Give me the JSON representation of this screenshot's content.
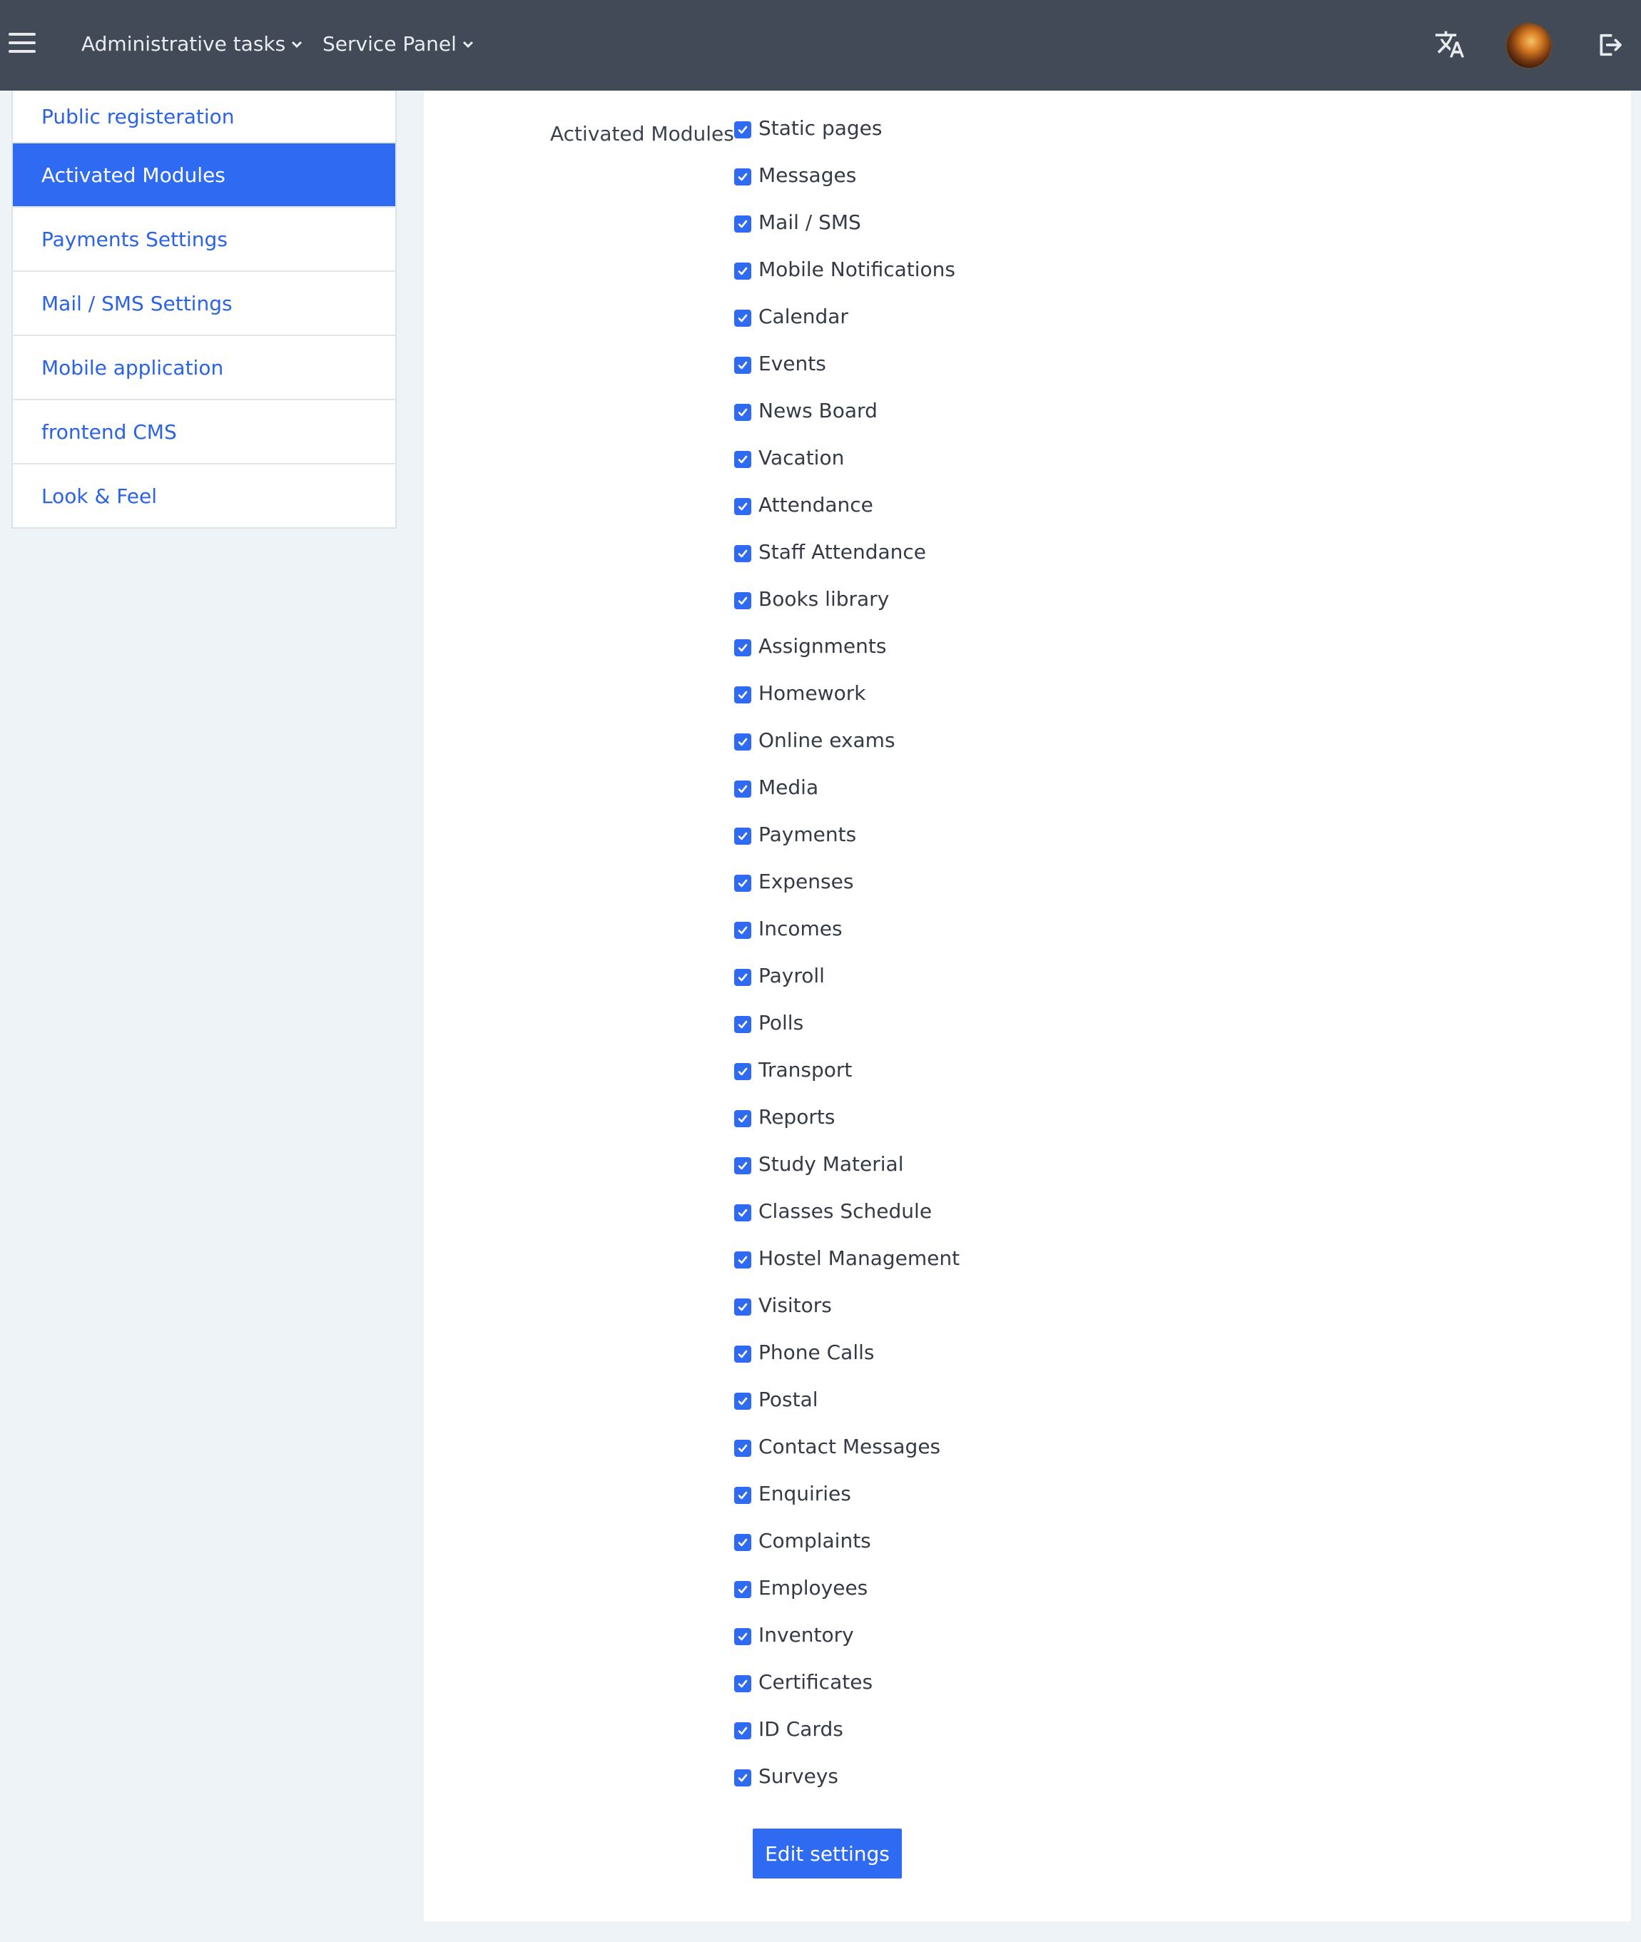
{
  "header": {
    "menu_icon": "hamburger-icon",
    "nav": [
      {
        "label": "Administrative tasks",
        "icon": "chevron-down-icon"
      },
      {
        "label": "Service Panel",
        "icon": "chevron-down-icon"
      }
    ],
    "right_icons": [
      "translate-icon",
      "avatar",
      "logout-icon"
    ]
  },
  "sidebar": {
    "items": [
      {
        "label": "Public registeration",
        "active": false
      },
      {
        "label": "Activated Modules",
        "active": true
      },
      {
        "label": "Payments Settings",
        "active": false
      },
      {
        "label": "Mail / SMS Settings",
        "active": false
      },
      {
        "label": "Mobile application",
        "active": false
      },
      {
        "label": "frontend CMS",
        "active": false
      },
      {
        "label": "Look & Feel",
        "active": false
      }
    ]
  },
  "form": {
    "label": "Activated Modules",
    "modules": [
      {
        "label": "Static pages",
        "checked": true
      },
      {
        "label": "Messages",
        "checked": true
      },
      {
        "label": "Mail / SMS",
        "checked": true
      },
      {
        "label": "Mobile Notifications",
        "checked": true
      },
      {
        "label": "Calendar",
        "checked": true
      },
      {
        "label": "Events",
        "checked": true
      },
      {
        "label": "News Board",
        "checked": true
      },
      {
        "label": "Vacation",
        "checked": true
      },
      {
        "label": "Attendance",
        "checked": true
      },
      {
        "label": "Staff Attendance",
        "checked": true
      },
      {
        "label": "Books library",
        "checked": true
      },
      {
        "label": "Assignments",
        "checked": true
      },
      {
        "label": "Homework",
        "checked": true
      },
      {
        "label": "Online exams",
        "checked": true
      },
      {
        "label": "Media",
        "checked": true
      },
      {
        "label": "Payments",
        "checked": true
      },
      {
        "label": "Expenses",
        "checked": true
      },
      {
        "label": "Incomes",
        "checked": true
      },
      {
        "label": "Payroll",
        "checked": true
      },
      {
        "label": "Polls",
        "checked": true
      },
      {
        "label": "Transport",
        "checked": true
      },
      {
        "label": "Reports",
        "checked": true
      },
      {
        "label": "Study Material",
        "checked": true
      },
      {
        "label": "Classes Schedule",
        "checked": true
      },
      {
        "label": "Hostel Management",
        "checked": true
      },
      {
        "label": "Visitors",
        "checked": true
      },
      {
        "label": "Phone Calls",
        "checked": true
      },
      {
        "label": "Postal",
        "checked": true
      },
      {
        "label": "Contact Messages",
        "checked": true
      },
      {
        "label": "Enquiries",
        "checked": true
      },
      {
        "label": "Complaints",
        "checked": true
      },
      {
        "label": "Employees",
        "checked": true
      },
      {
        "label": "Inventory",
        "checked": true
      },
      {
        "label": "Certificates",
        "checked": true
      },
      {
        "label": "ID Cards",
        "checked": true
      },
      {
        "label": "Surveys",
        "checked": true
      }
    ],
    "submit_label": "Edit settings"
  },
  "colors": {
    "topbar": "#424a57",
    "accent": "#2f6bf2",
    "page_bg": "#eef3f7",
    "link": "#2a62e8"
  }
}
